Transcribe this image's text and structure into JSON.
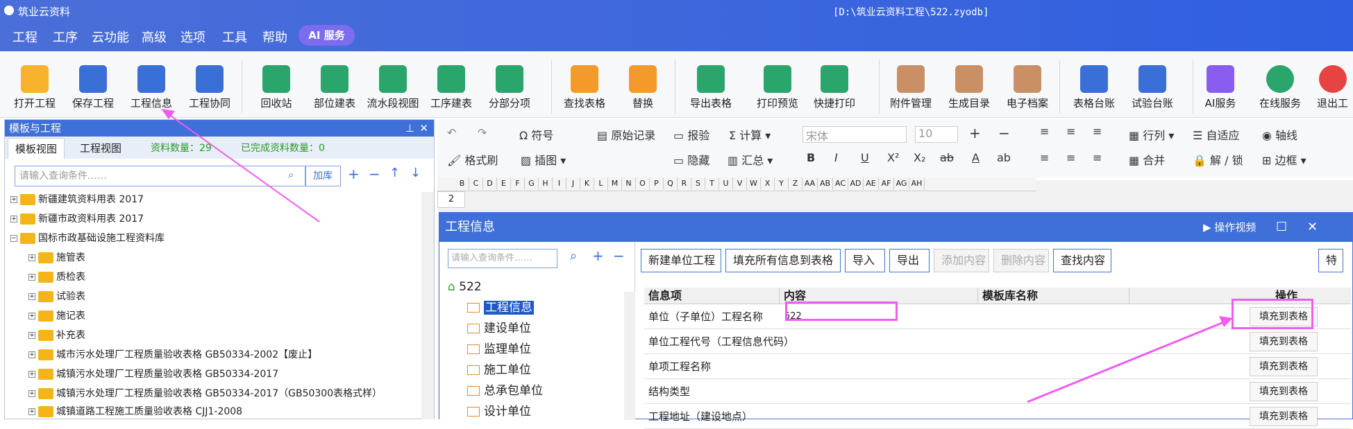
{
  "app": {
    "title": "筑业云资料",
    "file_path": "[D:\\筑业云资料工程\\522.zyodb]"
  },
  "menu": [
    "工程",
    "工序",
    "云功能",
    "高级",
    "选项",
    "工具",
    "帮助"
  ],
  "ai_button": "AI 服务",
  "toolbar": [
    "打开工程",
    "保存工程",
    "工程信息",
    "工程协同",
    "回收站",
    "部位建表",
    "流水段视图",
    "工序建表",
    "分部分项",
    "查找表格",
    "替换",
    "导出表格",
    "打印预览",
    "快捷打印",
    "附件管理",
    "生成目录",
    "电子档案",
    "表格台账",
    "试验台账",
    "AI服务",
    "在线服务",
    "退出工"
  ],
  "format_bar": {
    "symbol": "符号",
    "format_brush": "格式刷",
    "original_record": "原始记录",
    "check": "报验",
    "calculate": "计算",
    "hide": "隐藏",
    "summary": "汇总",
    "illustration": "插图",
    "font": "宋体",
    "font_size": "10",
    "row_col": "行列",
    "auto_fit": "自适应",
    "merge": "合并",
    "lock_unlock": "解 / 锁",
    "axis": "轴线",
    "border": "边框"
  },
  "left_panel": {
    "title": "模板与工程",
    "tabs": [
      "模板视图",
      "工程视图"
    ],
    "count_label": "资料数量：29",
    "done_label": "已完成资料数量：0",
    "search_placeholder": "请输入查询条件……",
    "load_button": "加库",
    "tree": [
      "新疆建筑资料用表 2017",
      "新疆市政资料用表 2017",
      "国标市政基础设施工程资料库",
      "施管表",
      "质检表",
      "试验表",
      "施记表",
      "补充表",
      "城市污水处理厂工程质量验收表格 GB50334-2002【废止】",
      "城镇污水处理厂工程质量验收表格 GB50334-2017",
      "城镇污水处理厂工程质量验收表格 GB50334-2017（GB50300表格式样）",
      "城镇道路工程施工质量验收表格 CJJ1-2008"
    ]
  },
  "sheet": {
    "columns": [
      "B",
      "C",
      "D",
      "E",
      "F",
      "G",
      "H",
      "I",
      "J",
      "K",
      "L",
      "M",
      "N",
      "O",
      "P",
      "Q",
      "R",
      "S",
      "T",
      "U",
      "V",
      "W",
      "X",
      "Y",
      "Z",
      "AA",
      "AB",
      "AC",
      "AD",
      "AE",
      "AF",
      "AG",
      "AH"
    ],
    "row": "2"
  },
  "dialog": {
    "title": "工程信息",
    "video": "操作视频",
    "search_placeholder": "请输入查询条件……",
    "root": "522",
    "nodes": [
      "工程信息",
      "建设单位",
      "监理单位",
      "施工单位",
      "总承包单位",
      "设计单位"
    ],
    "buttons": [
      "新建单位工程",
      "填充所有信息到表格",
      "导入",
      "导出",
      "添加内容",
      "删除内容",
      "查找内容",
      "特"
    ],
    "headers": [
      "信息项",
      "内容",
      "模板库名称",
      "操作"
    ],
    "rows": [
      {
        "item": "单位（子单位）工程名称",
        "content": "522"
      },
      {
        "item": "单位工程代号（工程信息代码）",
        "content": ""
      },
      {
        "item": "单项工程名称",
        "content": ""
      },
      {
        "item": "结构类型",
        "content": ""
      },
      {
        "item": "工程地址（建设地点）",
        "content": ""
      }
    ],
    "fill_label": "填充到表格"
  },
  "colors": {
    "titlebar": "#3d66dd",
    "accent": "#3f6fd8",
    "highlight": "#f05cf0"
  }
}
